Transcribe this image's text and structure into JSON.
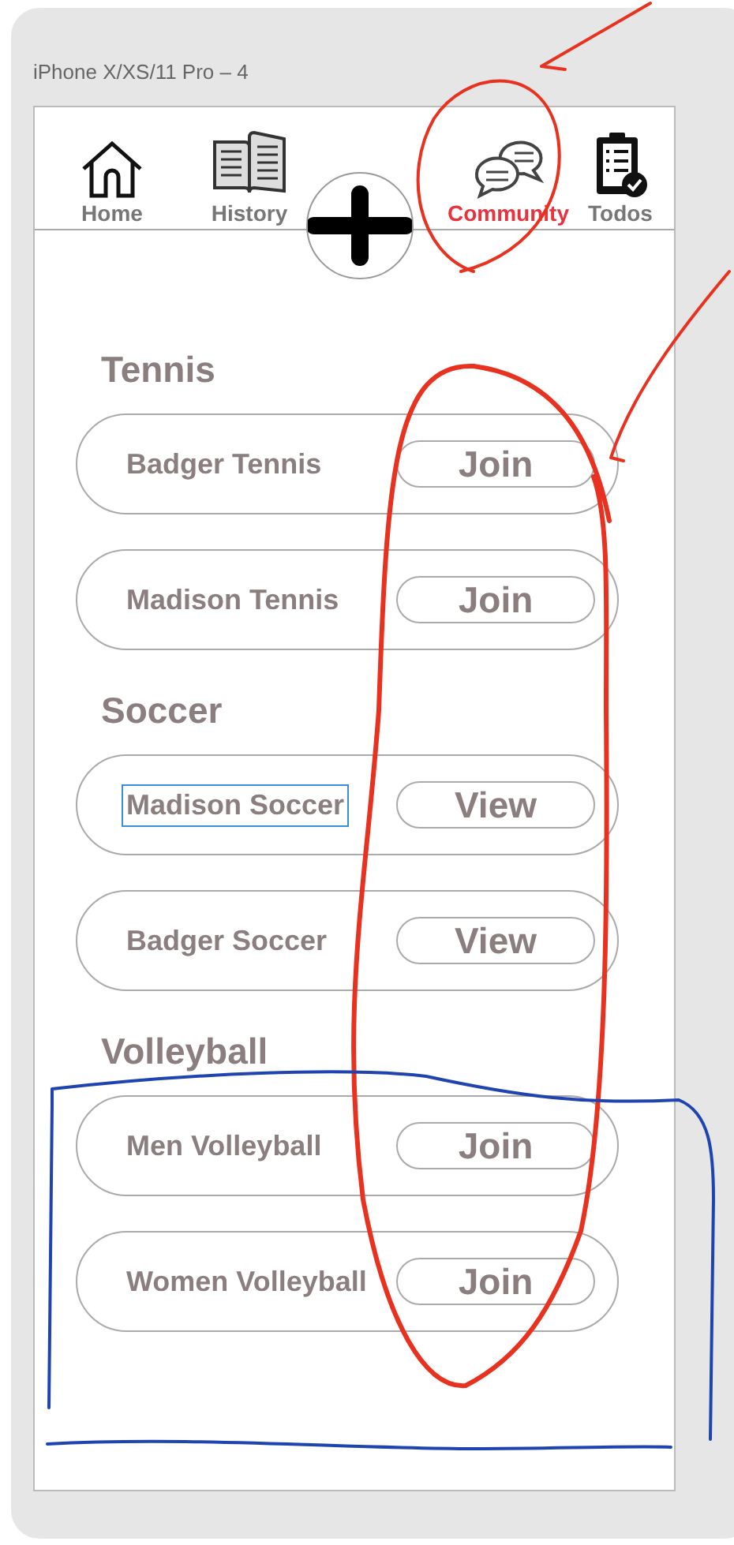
{
  "artboard": {
    "title": "iPhone X/XS/11 Pro – 4"
  },
  "nav": [
    {
      "label": "Home",
      "kind": "home",
      "selected": false
    },
    {
      "label": "History",
      "kind": "book",
      "selected": false
    },
    {
      "label": "Community",
      "kind": "chat",
      "selected": true
    },
    {
      "label": "Todos",
      "kind": "todo",
      "selected": false
    }
  ],
  "sections": [
    {
      "title": "Tennis",
      "groups": [
        {
          "name": "Badger Tennis",
          "action": "Join",
          "selected": false
        },
        {
          "name": "Madison Tennis",
          "action": "Join",
          "selected": false
        }
      ]
    },
    {
      "title": "Soccer",
      "groups": [
        {
          "name": "Madison Soccer",
          "action": "View",
          "selected": true
        },
        {
          "name": "Badger Soccer",
          "action": "View",
          "selected": false
        }
      ]
    },
    {
      "title": "Volleyball",
      "groups": [
        {
          "name": "Men Volleyball",
          "action": "Join",
          "selected": false
        },
        {
          "name": "Women Volleyball",
          "action": "Join",
          "selected": false
        }
      ]
    }
  ]
}
